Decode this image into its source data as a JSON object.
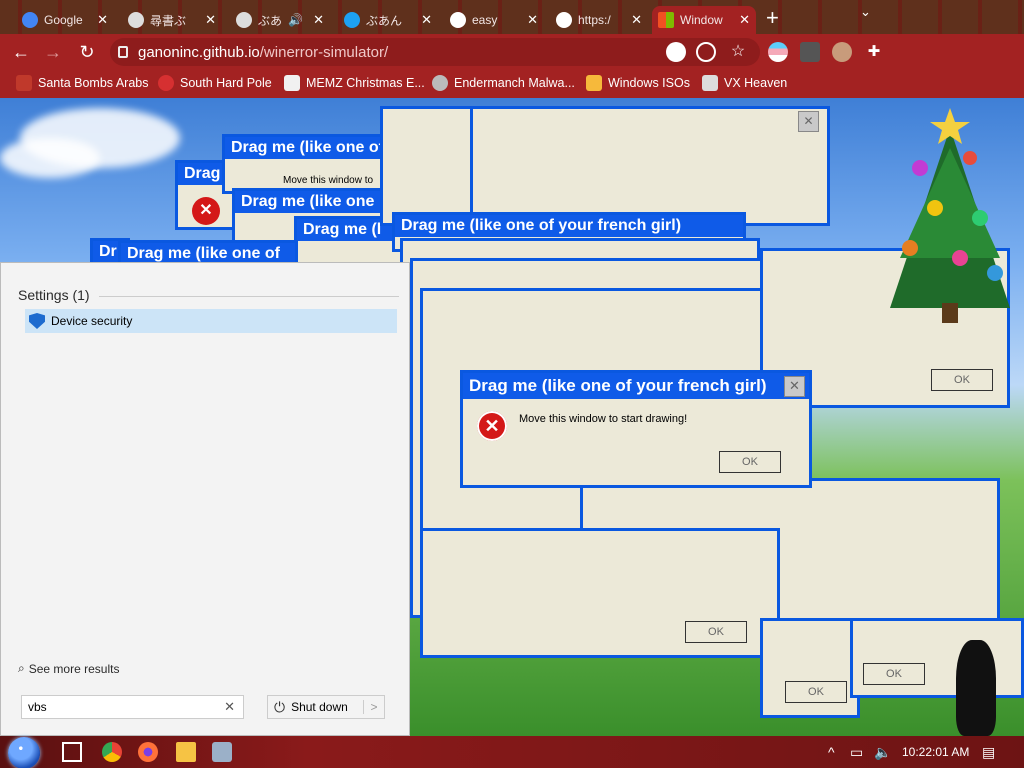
{
  "browser": {
    "tabs": [
      {
        "label": "Google",
        "active": false
      },
      {
        "label": "尋書ぶ",
        "active": false
      },
      {
        "label": "ぶあ",
        "active": false
      },
      {
        "label": "ぶあん",
        "active": false
      },
      {
        "label": "easy",
        "active": false
      },
      {
        "label": "https:/",
        "active": false
      },
      {
        "label": "Window",
        "active": true
      }
    ],
    "close_glyph": "✕",
    "new_tab_glyph": "+",
    "url_host": "ganoninc.github.io",
    "url_path": "/winerror-simulator/",
    "bookmarks": [
      {
        "label": "Santa Bombs Arabs",
        "icon": "santa-icon",
        "color": "#c0392b"
      },
      {
        "label": "South Hard Pole",
        "icon": "flower-icon",
        "color": "#d63031"
      },
      {
        "label": "MEMZ Christmas E...",
        "icon": "page-icon",
        "color": "#f1f1f1"
      },
      {
        "label": "Endermanch Malwa...",
        "icon": "skull-icon",
        "color": "#bbbbbb"
      },
      {
        "label": "Windows ISOs",
        "icon": "windows-icon",
        "color": "#f6b93b"
      },
      {
        "label": "VX Heaven",
        "icon": "shield-icon",
        "color": "#dddddd"
      }
    ]
  },
  "error_window": {
    "title": "Drag me (like one of your french girl)",
    "message": "Move this window to start drawing!",
    "ok_label": "OK",
    "close_glyph": "✕",
    "error_glyph": "✕"
  },
  "stack_windows": {
    "titles": [
      "Drag me (like one of",
      "Drag me (like one",
      "Drag",
      "Drag me (l",
      "Drag me (like one of your french girl)",
      "Dr",
      "Drag me (like one of"
    ],
    "small_msg": "Move this window to"
  },
  "search_panel": {
    "group_label": "Settings (1)",
    "result_label": "Device security",
    "see_more": "See more results",
    "query": "vbs",
    "clear_glyph": "✕",
    "shutdown_label": "Shut down",
    "arrow_glyph": ">"
  },
  "taskbar": {
    "time": "10:22:01 AM",
    "tray_up": "^"
  },
  "colors": {
    "xp_title_blue": "#0f5be8",
    "xp_body": "#ece9d8",
    "chrome_theme": "#a32222",
    "error_red": "#d41818",
    "result_highlight": "#cce4f7"
  }
}
